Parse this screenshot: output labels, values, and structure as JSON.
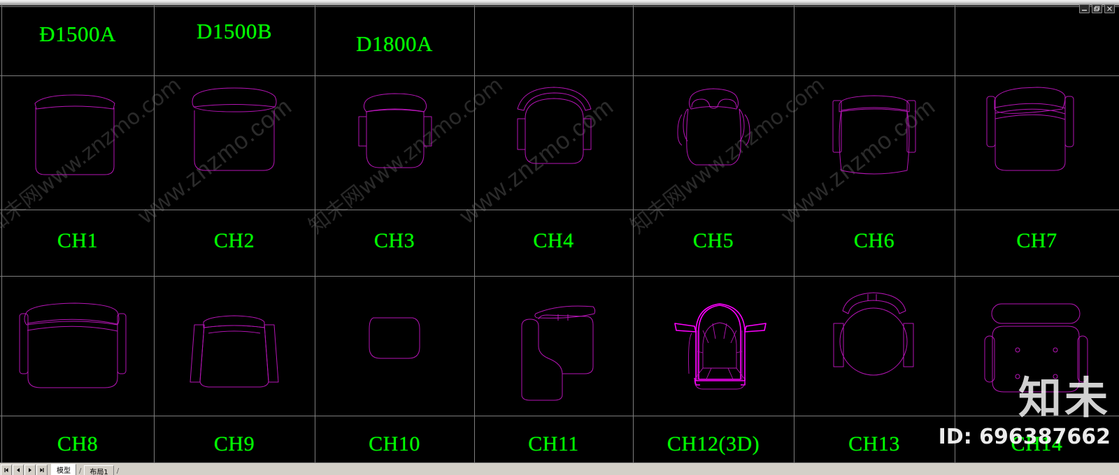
{
  "window": {
    "controls": [
      {
        "name": "minimize-button",
        "glyph": "minimize"
      },
      {
        "name": "restore-button",
        "glyph": "restore"
      },
      {
        "name": "close-button",
        "glyph": "close"
      }
    ]
  },
  "drawing": {
    "background_color": "#000000",
    "grid_color": "#7d7d7d",
    "label_color": "#00ff00",
    "linework_color": "#b515b5",
    "highlight_color": "#ff00ff",
    "columns": 7,
    "rows": [
      {
        "row_name": "table-labels-row",
        "cells": [
          {
            "label": "Ð1500A",
            "drawing": "none"
          },
          {
            "label": "D1500B",
            "drawing": "none"
          },
          {
            "label": "D1800A",
            "drawing": "none"
          },
          {
            "label": "",
            "drawing": "none"
          },
          {
            "label": "",
            "drawing": "none"
          },
          {
            "label": "",
            "drawing": "none"
          },
          {
            "label": "",
            "drawing": "none"
          }
        ]
      },
      {
        "row_name": "chair-plans-row-1",
        "cells": [
          {
            "label": "",
            "drawing": "chair-plan-ch1"
          },
          {
            "label": "",
            "drawing": "chair-plan-ch2"
          },
          {
            "label": "",
            "drawing": "chair-plan-ch3"
          },
          {
            "label": "",
            "drawing": "chair-plan-ch4"
          },
          {
            "label": "",
            "drawing": "chair-plan-ch5"
          },
          {
            "label": "",
            "drawing": "chair-plan-ch6"
          },
          {
            "label": "",
            "drawing": "chair-plan-ch7"
          }
        ]
      },
      {
        "row_name": "chair-labels-row-1",
        "cells": [
          {
            "label": "CH1",
            "drawing": "none"
          },
          {
            "label": "CH2",
            "drawing": "none"
          },
          {
            "label": "CH3",
            "drawing": "none"
          },
          {
            "label": "CH4",
            "drawing": "none"
          },
          {
            "label": "CH5",
            "drawing": "none"
          },
          {
            "label": "CH6",
            "drawing": "none"
          },
          {
            "label": "CH7",
            "drawing": "none"
          }
        ]
      },
      {
        "row_name": "chair-plans-row-2",
        "cells": [
          {
            "label": "",
            "drawing": "chair-plan-ch8"
          },
          {
            "label": "",
            "drawing": "chair-plan-ch9"
          },
          {
            "label": "",
            "drawing": "chair-plan-ch10"
          },
          {
            "label": "",
            "drawing": "chair-plan-ch11"
          },
          {
            "label": "",
            "drawing": "chair-3d-ch12"
          },
          {
            "label": "",
            "drawing": "chair-plan-ch13"
          },
          {
            "label": "",
            "drawing": "chair-plan-ch14"
          }
        ]
      },
      {
        "row_name": "chair-labels-row-2",
        "cells": [
          {
            "label": "CH8",
            "drawing": "none"
          },
          {
            "label": "CH9",
            "drawing": "none"
          },
          {
            "label": "CH10",
            "drawing": "none"
          },
          {
            "label": "CH11",
            "drawing": "none"
          },
          {
            "label": "CH12(3D)",
            "drawing": "none"
          },
          {
            "label": "CH13",
            "drawing": "none"
          },
          {
            "label": "CH14",
            "drawing": "none"
          }
        ]
      }
    ]
  },
  "watermarks": {
    "diagonal_url_1": "www.znzmo.com",
    "diagonal_url_2": "www.znzmo.com",
    "diagonal_url_3": "www.znzmo.com",
    "diagonal_cn_1": "知未网www.znzmo.com",
    "diagonal_cn_2": "知未网www.znzmo.com",
    "diagonal_cn_3": "知未网www.znzmo.com",
    "logo_text": "知未",
    "id_text": "ID: 696387662"
  },
  "statusbar": {
    "nav_first_label": "first-layout",
    "nav_prev_label": "previous-layout",
    "nav_next_label": "next-layout",
    "nav_last_label": "last-layout",
    "tabs": [
      {
        "label": "模型",
        "active": true
      },
      {
        "label": "布局1",
        "active": false
      }
    ],
    "separator": "/"
  }
}
